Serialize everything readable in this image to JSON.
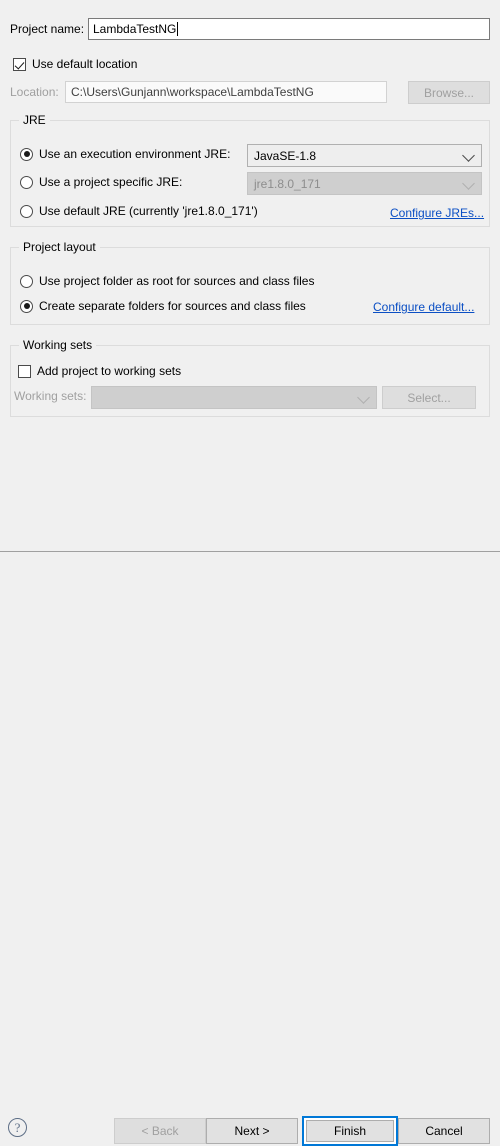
{
  "form": {
    "project_name_label": "Project name:",
    "project_name_value": "LambdaTestNG",
    "use_default_location_label": "Use default location",
    "location_label": "Location:",
    "location_value": "C:\\Users\\Gunjann\\workspace\\LambdaTestNG",
    "browse_label": "Browse..."
  },
  "jre": {
    "group_title": "JRE",
    "option_exec_env": "Use an execution environment JRE:",
    "option_project_jre": "Use a project specific JRE:",
    "option_default_jre": "Use default JRE (currently 'jre1.8.0_171')",
    "exec_env_value": "JavaSE-1.8",
    "project_jre_value": "jre1.8.0_171",
    "configure_jres_link": "Configure JREs..."
  },
  "layout": {
    "group_title": "Project layout",
    "option_project_folder_root": "Use project folder as root for sources and class files",
    "option_separate_folders": "Create separate folders for sources and class files",
    "configure_default_link": "Configure default..."
  },
  "working_sets": {
    "group_title": "Working sets",
    "add_project_label": "Add project to working sets",
    "working_sets_label": "Working sets:",
    "working_sets_value": "",
    "select_label": "Select..."
  },
  "footer": {
    "help_glyph": "?",
    "back_label": "< Back",
    "next_label": "Next >",
    "finish_label": "Finish",
    "cancel_label": "Cancel"
  },
  "colors": {
    "dialog_bg": "#f0f0f0",
    "link": "#0b4fc4",
    "focus_border": "#0078d7",
    "button_face": "#e1e1e1",
    "disabled_text": "#a0a0a0"
  }
}
